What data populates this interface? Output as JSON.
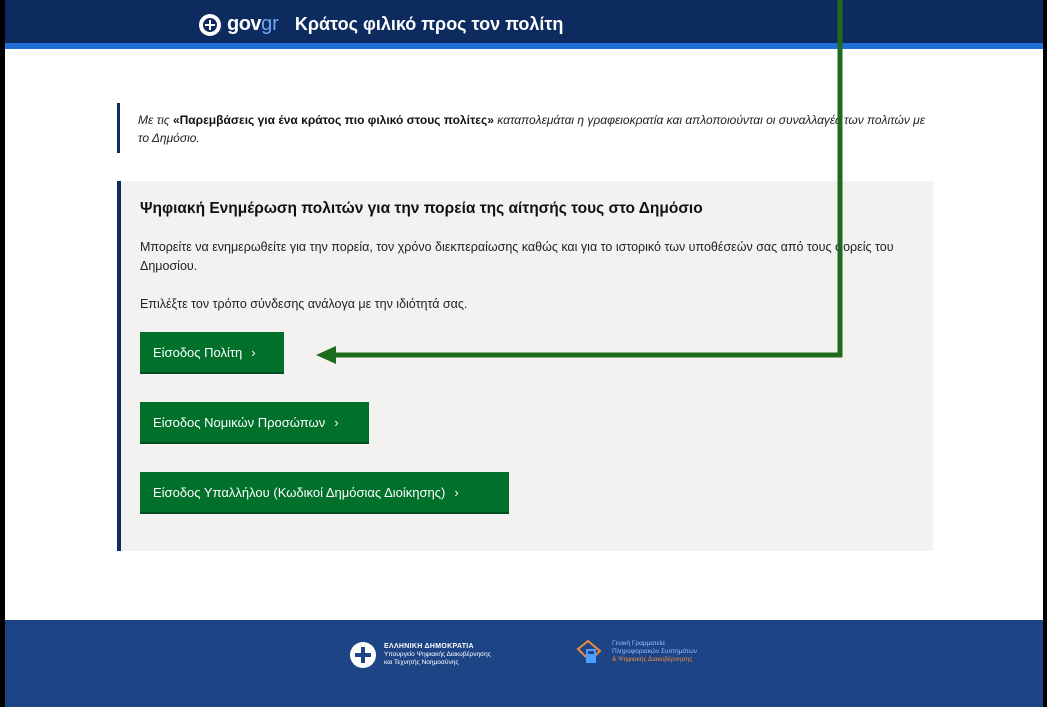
{
  "header": {
    "logo_gov": "gov",
    "logo_gr": "gr",
    "tagline": "Κράτος φιλικό προς τον πολίτη"
  },
  "intro": {
    "prefix": "Με τις ",
    "bold": "«Παρεμβάσεις για ένα κράτος πιο φιλικό στους πολίτες»",
    "suffix": " καταπολεμάται η γραφειοκρατία και απλοποιούνται οι συναλλαγές των πολιτών με το Δημόσιο."
  },
  "panel": {
    "title": "Ψηφιακή Ενημέρωση πολιτών για την πορεία της αίτησής τους στο Δημόσιο",
    "description": "Μπορείτε να ενημερωθείτε για την πορεία, τον χρόνο διεκπεραίωσης καθώς και για το ιστορικό των υποθέσεών σας από τους φορείς του Δημοσίου.",
    "choose_text": "Επιλέξτε τον τρόπο σύνδεσης ανάλογα με την ιδιότητά σας.",
    "buttons": [
      {
        "label": "Είσοδος Πολίτη"
      },
      {
        "label": "Είσοδος Νομικών Προσώπων"
      },
      {
        "label": "Είσοδος Υπαλλήλου (Κωδικοί Δημόσιας Διοίκησης)"
      }
    ],
    "chevron": "›"
  },
  "footer": {
    "org1_title": "ΕΛΛΗΝΙΚΗ ΔΗΜΟΚΡΑΤΙΑ",
    "org1_line2": "Υπουργείο Ψηφιακής Διακυβέρνησης",
    "org1_line3": "και Τεχνητής Νοημοσύνης",
    "org2_line1": "Γενική Γραμματεία",
    "org2_line2": "Πληροφοριακών Συστημάτων",
    "org2_line3": "& Ψηφιακής Διακυβέρνησης"
  },
  "colors": {
    "header_bg": "#0d2b5e",
    "button_green": "#00702b",
    "annotation_arrow": "#1e6b1e",
    "footer_bg": "#1d4585"
  }
}
